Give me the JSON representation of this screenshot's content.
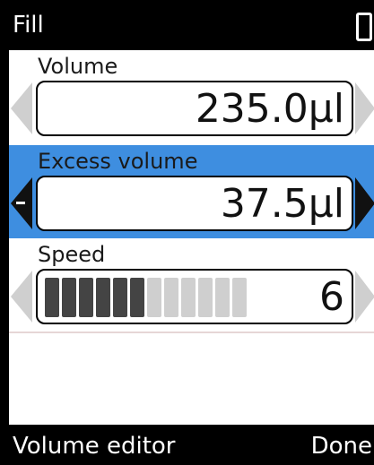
{
  "title_bar": {
    "title": "Fill",
    "battery_icon": "battery-icon"
  },
  "fields": [
    {
      "label": "Volume",
      "value": "235.0µl",
      "selected": false
    },
    {
      "label": "Excess volume",
      "value": "37.5µl",
      "selected": true
    },
    {
      "label": "Speed",
      "value": "6",
      "level": 6,
      "max_level": 12,
      "selected": false
    }
  ],
  "softkeys": {
    "left": "Volume editor",
    "right": "Done"
  },
  "colors": {
    "selected_row": "#3e8ee0",
    "bar_on": "#444444",
    "bar_off": "#cfcfcf"
  }
}
